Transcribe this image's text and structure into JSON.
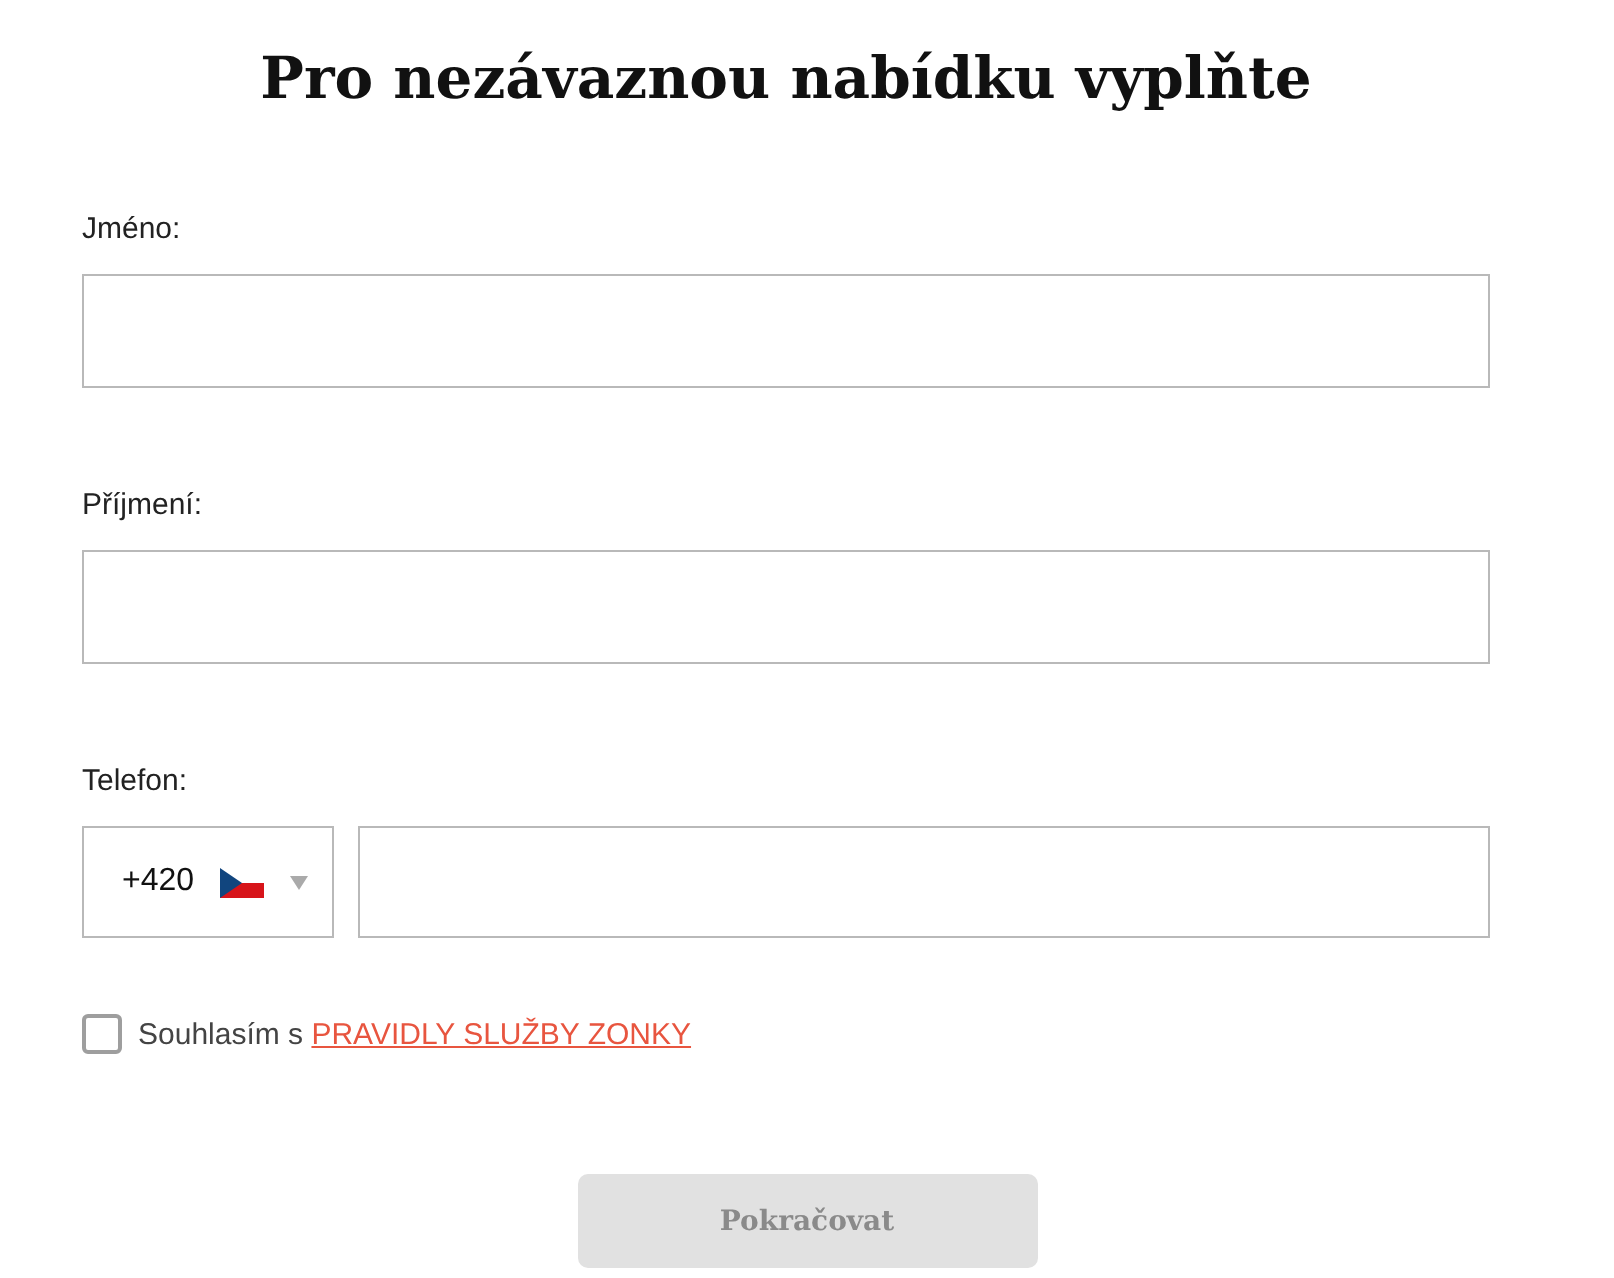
{
  "title": "Pro nezávaznou nabídku vyplňte",
  "fields": [
    {
      "label": "Jméno:"
    },
    {
      "label": "Příjmení:"
    }
  ],
  "phone": {
    "label": "Telefon:",
    "prefix": "+420"
  },
  "consent": {
    "checked": false,
    "text": "Souhlasím s",
    "link": "PRAVIDLY SLUŽBY ZONKY"
  },
  "submit": {
    "label": "Pokračovat",
    "disabled": true
  }
}
